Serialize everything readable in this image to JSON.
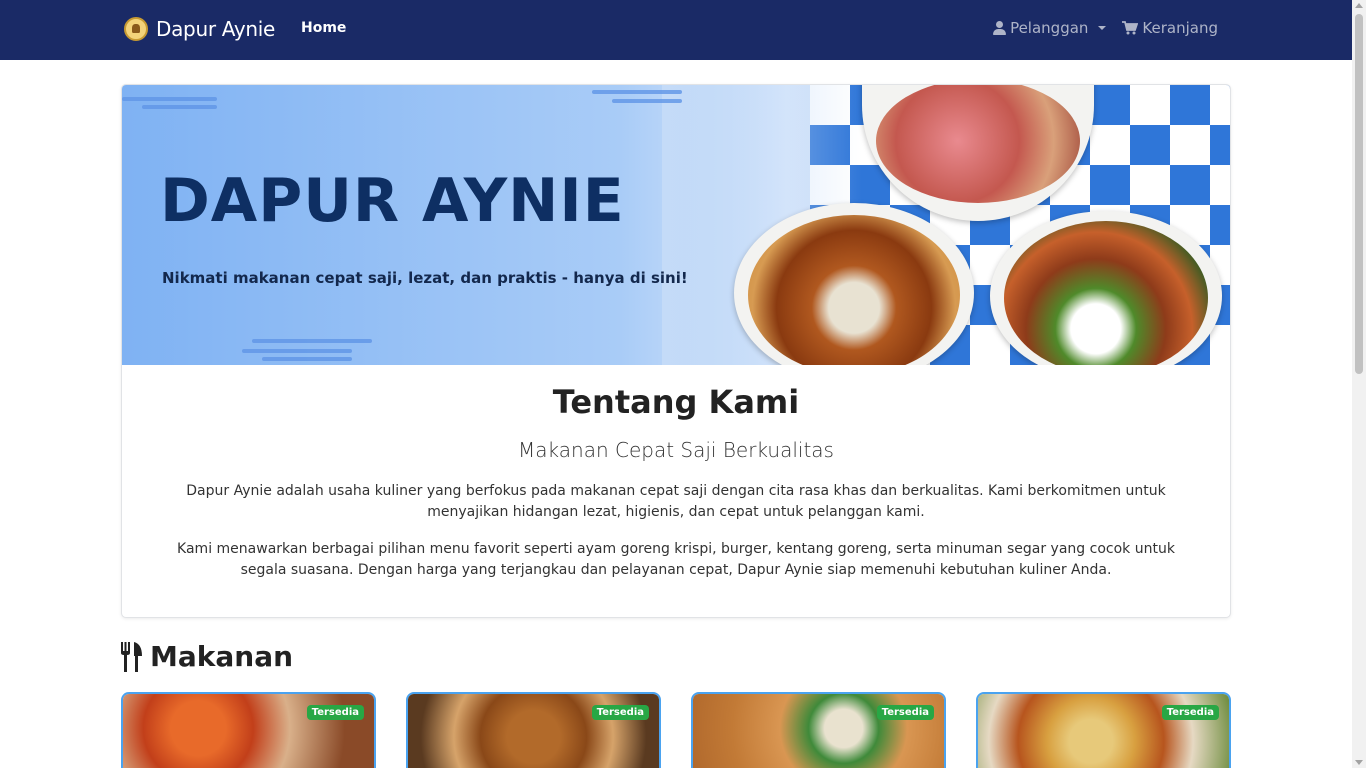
{
  "navbar": {
    "brand": "Dapur Aynie",
    "home": "Home",
    "pelanggan": "Pelanggan",
    "keranjang": "Keranjang",
    "bg_color": "#1a2a66"
  },
  "banner": {
    "title": "DAPUR AYNIE",
    "subtitle": "Nikmati makanan cepat saji, lezat, dan praktis - hanya di sini!"
  },
  "about": {
    "title": "Tentang Kami",
    "subtitle": "Makanan Cepat Saji Berkualitas",
    "p1": "Dapur Aynie adalah usaha kuliner yang berfokus pada makanan cepat saji dengan cita rasa khas dan berkualitas. Kami berkomitmen untuk menyajikan hidangan lezat, higienis, dan cepat untuk pelanggan kami.",
    "p2": "Kami menawarkan berbagai pilihan menu favorit seperti ayam goreng krispi, burger, kentang goreng, serta minuman segar yang cocok untuk segala suasana. Dengan harga yang terjangkau dan pelayanan cepat, Dapur Aynie siap memenuhi kebutuhan kuliner Anda."
  },
  "section": {
    "title": "Makanan",
    "icon": "utensils-icon"
  },
  "menu_cards": [
    {
      "badge": "Tersedia"
    },
    {
      "badge": "Tersedia"
    },
    {
      "badge": "Tersedia"
    },
    {
      "badge": "Tersedia"
    }
  ],
  "colors": {
    "badge_green": "#28a745",
    "card_border": "#4aa3f0"
  }
}
